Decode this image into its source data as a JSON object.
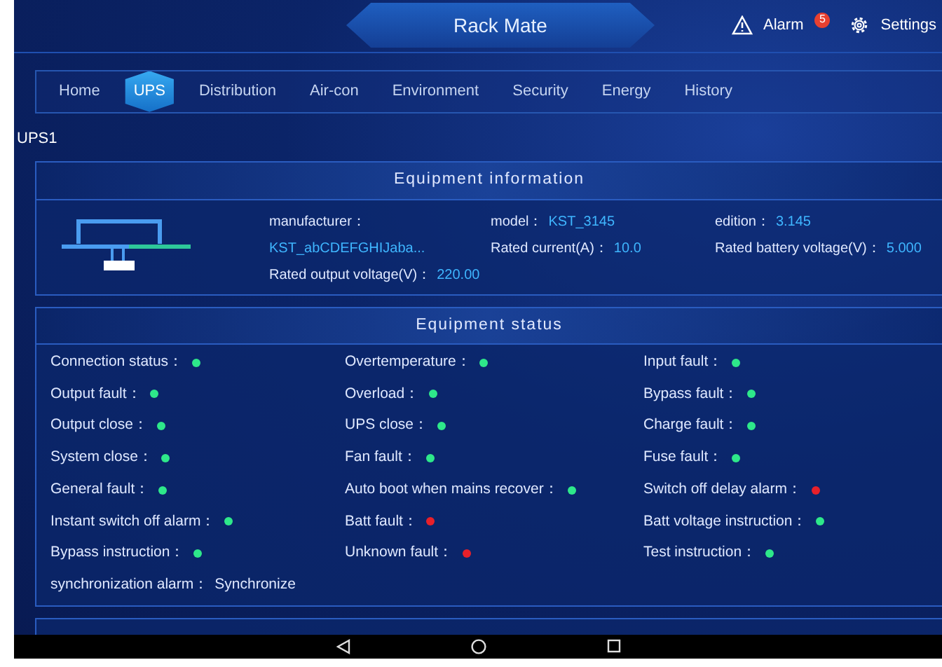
{
  "header": {
    "title": "Rack Mate",
    "alarm_label": "Alarm",
    "alarm_count": "5",
    "settings_label": "Settings"
  },
  "tabs": [
    {
      "label": "Home",
      "selected": false
    },
    {
      "label": "UPS",
      "selected": true
    },
    {
      "label": "Distribution",
      "selected": false
    },
    {
      "label": "Air-con",
      "selected": false
    },
    {
      "label": "Environment",
      "selected": false
    },
    {
      "label": "Security",
      "selected": false
    },
    {
      "label": "Energy",
      "selected": false
    },
    {
      "label": "History",
      "selected": false
    }
  ],
  "device_name": "UPS1",
  "info": {
    "title": "Equipment information",
    "fields": [
      {
        "label": "manufacturer："
      },
      {
        "label": "model：",
        "value": "KST_3145"
      },
      {
        "label": "edition：",
        "value": "3.145"
      },
      {
        "value": "KST_abCDEFGHIJaba..."
      },
      {
        "label": "Rated current(A)：",
        "value": "10.0"
      },
      {
        "label": "Rated battery voltage(V)：",
        "value": "5.000"
      },
      {
        "label": "Rated output voltage(V)：",
        "value": "220.00"
      }
    ]
  },
  "status": {
    "title": "Equipment status",
    "items": [
      {
        "label": "Connection status：",
        "kind": "dot",
        "color": "#2ee88a"
      },
      {
        "label": "Overtemperature：",
        "kind": "dot",
        "color": "#2ee88a"
      },
      {
        "label": "Input fault：",
        "kind": "dot",
        "color": "#2ee88a"
      },
      {
        "label": "Output fault：",
        "kind": "dot",
        "color": "#2ee88a"
      },
      {
        "label": "Overload：",
        "kind": "dot",
        "color": "#2ee88a"
      },
      {
        "label": "Bypass fault：",
        "kind": "dot",
        "color": "#2ee88a"
      },
      {
        "label": "Output close：",
        "kind": "dot",
        "color": "#2ee88a"
      },
      {
        "label": "UPS close：",
        "kind": "dot",
        "color": "#2ee88a"
      },
      {
        "label": "Charge fault：",
        "kind": "dot",
        "color": "#2ee88a"
      },
      {
        "label": "System close：",
        "kind": "dot",
        "color": "#2ee88a"
      },
      {
        "label": "Fan fault：",
        "kind": "dot",
        "color": "#2ee88a"
      },
      {
        "label": "Fuse fault：",
        "kind": "dot",
        "color": "#2ee88a"
      },
      {
        "label": "General fault：",
        "kind": "dot",
        "color": "#2ee88a"
      },
      {
        "label": "Auto boot when mains recover：",
        "kind": "dot",
        "color": "#2ee88a"
      },
      {
        "label": "Switch off delay alarm：",
        "kind": "dot",
        "color": "#e8202a"
      },
      {
        "label": "Instant switch off alarm：",
        "kind": "dot",
        "color": "#2ee88a"
      },
      {
        "label": "Batt fault：",
        "kind": "dot",
        "color": "#e8202a"
      },
      {
        "label": "Batt voltage instruction：",
        "kind": "dot",
        "color": "#2ee88a"
      },
      {
        "label": "Bypass instruction：",
        "kind": "dot",
        "color": "#2ee88a"
      },
      {
        "label": "Unknown fault：",
        "kind": "dot",
        "color": "#e8202a"
      },
      {
        "label": "Test instruction：",
        "kind": "dot",
        "color": "#2ee88a"
      },
      {
        "label": "synchronization alarm：",
        "kind": "text",
        "value": "Synchronize"
      }
    ]
  }
}
